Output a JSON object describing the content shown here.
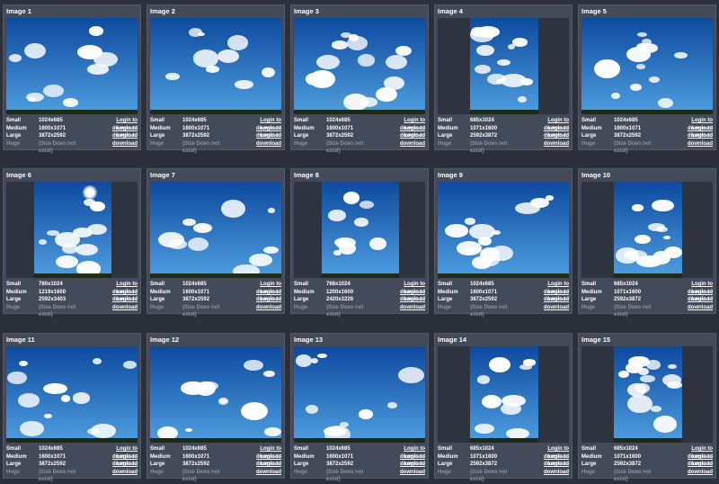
{
  "images": [
    {
      "title": "Image 1",
      "orientation": "landscape",
      "sizes": [
        {
          "label": "Small",
          "dim": "1024x685",
          "action": "Login to download"
        },
        {
          "label": "Medium",
          "dim": "1600x1071",
          "action": "Login to download"
        },
        {
          "label": "Large",
          "dim": "3872x2592",
          "action": "Login to download"
        },
        {
          "label": "Huge",
          "dim": "(Size Does not exist)",
          "action": ""
        }
      ]
    },
    {
      "title": "Image 2",
      "orientation": "landscape",
      "sizes": [
        {
          "label": "Small",
          "dim": "1024x685",
          "action": "Login to download"
        },
        {
          "label": "Medium",
          "dim": "1600x1071",
          "action": "Login to download"
        },
        {
          "label": "Large",
          "dim": "3872x2592",
          "action": "Login to download"
        },
        {
          "label": "Huge",
          "dim": "(Size Does not exist)",
          "action": ""
        }
      ]
    },
    {
      "title": "Image 3",
      "orientation": "landscape",
      "sizes": [
        {
          "label": "Small",
          "dim": "1024x685",
          "action": "Login to download"
        },
        {
          "label": "Medium",
          "dim": "1600x1071",
          "action": "Login to download"
        },
        {
          "label": "Large",
          "dim": "3872x2592",
          "action": "Login to download"
        },
        {
          "label": "Huge",
          "dim": "(Size Does not exist)",
          "action": ""
        }
      ]
    },
    {
      "title": "Image 4",
      "orientation": "portrait",
      "sizes": [
        {
          "label": "Small",
          "dim": "685x1024",
          "action": "Login to download"
        },
        {
          "label": "Medium",
          "dim": "1071x1600",
          "action": "Login to download"
        },
        {
          "label": "Large",
          "dim": "2592x3872",
          "action": "Login to download"
        },
        {
          "label": "Huge",
          "dim": "(Size Does not exist)",
          "action": ""
        }
      ]
    },
    {
      "title": "Image 5",
      "orientation": "landscape",
      "sizes": [
        {
          "label": "Small",
          "dim": "1024x685",
          "action": "Login to download"
        },
        {
          "label": "Medium",
          "dim": "1600x1071",
          "action": "Login to download"
        },
        {
          "label": "Large",
          "dim": "3872x2592",
          "action": "Login to download"
        },
        {
          "label": "Huge",
          "dim": "(Size Does not exist)",
          "action": ""
        }
      ]
    },
    {
      "title": "Image 6",
      "orientation": "portrait-wide",
      "sizes": [
        {
          "label": "Small",
          "dim": "780x1024",
          "action": "Login to download"
        },
        {
          "label": "Medium",
          "dim": "1219x1600",
          "action": "Login to download"
        },
        {
          "label": "Large",
          "dim": "2592x3403",
          "action": "Login to download"
        },
        {
          "label": "Huge",
          "dim": "(Size Does not exist)",
          "action": ""
        }
      ]
    },
    {
      "title": "Image 7",
      "orientation": "landscape",
      "sizes": [
        {
          "label": "Small",
          "dim": "1024x685",
          "action": "Login to download"
        },
        {
          "label": "Medium",
          "dim": "1600x1071",
          "action": "Login to download"
        },
        {
          "label": "Large",
          "dim": "3872x2592",
          "action": "Login to download"
        },
        {
          "label": "Huge",
          "dim": "(Size Does not exist)",
          "action": ""
        }
      ]
    },
    {
      "title": "Image 8",
      "orientation": "portrait-wide",
      "sizes": [
        {
          "label": "Small",
          "dim": "768x1024",
          "action": "Login to download"
        },
        {
          "label": "Medium",
          "dim": "1200x1600",
          "action": "Login to download"
        },
        {
          "label": "Large",
          "dim": "2420x3226",
          "action": "Login to download"
        },
        {
          "label": "Huge",
          "dim": "(Size Does not exist)",
          "action": ""
        }
      ]
    },
    {
      "title": "Image 9",
      "orientation": "landscape",
      "sizes": [
        {
          "label": "Small",
          "dim": "1024x685",
          "action": "Login to download"
        },
        {
          "label": "Medium",
          "dim": "1600x1071",
          "action": "Login to download"
        },
        {
          "label": "Large",
          "dim": "3872x2592",
          "action": "Login to download"
        },
        {
          "label": "Huge",
          "dim": "(Size Does not exist)",
          "action": ""
        }
      ]
    },
    {
      "title": "Image 10",
      "orientation": "portrait",
      "sizes": [
        {
          "label": "Small",
          "dim": "685x1024",
          "action": "Login to download"
        },
        {
          "label": "Medium",
          "dim": "1071x1600",
          "action": "Login to download"
        },
        {
          "label": "Large",
          "dim": "2592x3872",
          "action": "Login to download"
        },
        {
          "label": "Huge",
          "dim": "(Size Does not exist)",
          "action": ""
        }
      ]
    },
    {
      "title": "Image 11",
      "orientation": "landscape",
      "sizes": [
        {
          "label": "Small",
          "dim": "1024x685",
          "action": "Login to download"
        },
        {
          "label": "Medium",
          "dim": "1600x1071",
          "action": "Login to download"
        },
        {
          "label": "Large",
          "dim": "3872x2592",
          "action": "Login to download"
        },
        {
          "label": "Huge",
          "dim": "(Size Does not exist)",
          "action": ""
        }
      ]
    },
    {
      "title": "Image 12",
      "orientation": "landscape",
      "sizes": [
        {
          "label": "Small",
          "dim": "1024x685",
          "action": "Login to download"
        },
        {
          "label": "Medium",
          "dim": "1600x1071",
          "action": "Login to download"
        },
        {
          "label": "Large",
          "dim": "3872x2592",
          "action": "Login to download"
        },
        {
          "label": "Huge",
          "dim": "(Size Does not exist)",
          "action": ""
        }
      ]
    },
    {
      "title": "Image 13",
      "orientation": "landscape",
      "sizes": [
        {
          "label": "Small",
          "dim": "1024x685",
          "action": "Login to download"
        },
        {
          "label": "Medium",
          "dim": "1600x1071",
          "action": "Login to download"
        },
        {
          "label": "Large",
          "dim": "3872x2592",
          "action": "Login to download"
        },
        {
          "label": "Huge",
          "dim": "(Size Does not exist)",
          "action": ""
        }
      ]
    },
    {
      "title": "Image 14",
      "orientation": "portrait",
      "sizes": [
        {
          "label": "Small",
          "dim": "685x1024",
          "action": "Login to download"
        },
        {
          "label": "Medium",
          "dim": "1071x1600",
          "action": "Login to download"
        },
        {
          "label": "Large",
          "dim": "2592x3872",
          "action": "Login to download"
        },
        {
          "label": "Huge",
          "dim": "(Size Does not exist)",
          "action": ""
        }
      ]
    },
    {
      "title": "Image 15",
      "orientation": "portrait",
      "sizes": [
        {
          "label": "Small",
          "dim": "685x1024",
          "action": "Login to download"
        },
        {
          "label": "Medium",
          "dim": "1071x1600",
          "action": "Login to download"
        },
        {
          "label": "Large",
          "dim": "2592x3872",
          "action": "Login to download"
        },
        {
          "label": "Huge",
          "dim": "(Size Does not exist)",
          "action": ""
        }
      ]
    }
  ],
  "colors": {
    "page_background": "#2b303b",
    "card_background": "#434a59",
    "sky_top": "#0d4a9e",
    "sky_bottom": "#4f9ee0",
    "text": "#ffffff",
    "muted_text": "#8d93a0"
  }
}
